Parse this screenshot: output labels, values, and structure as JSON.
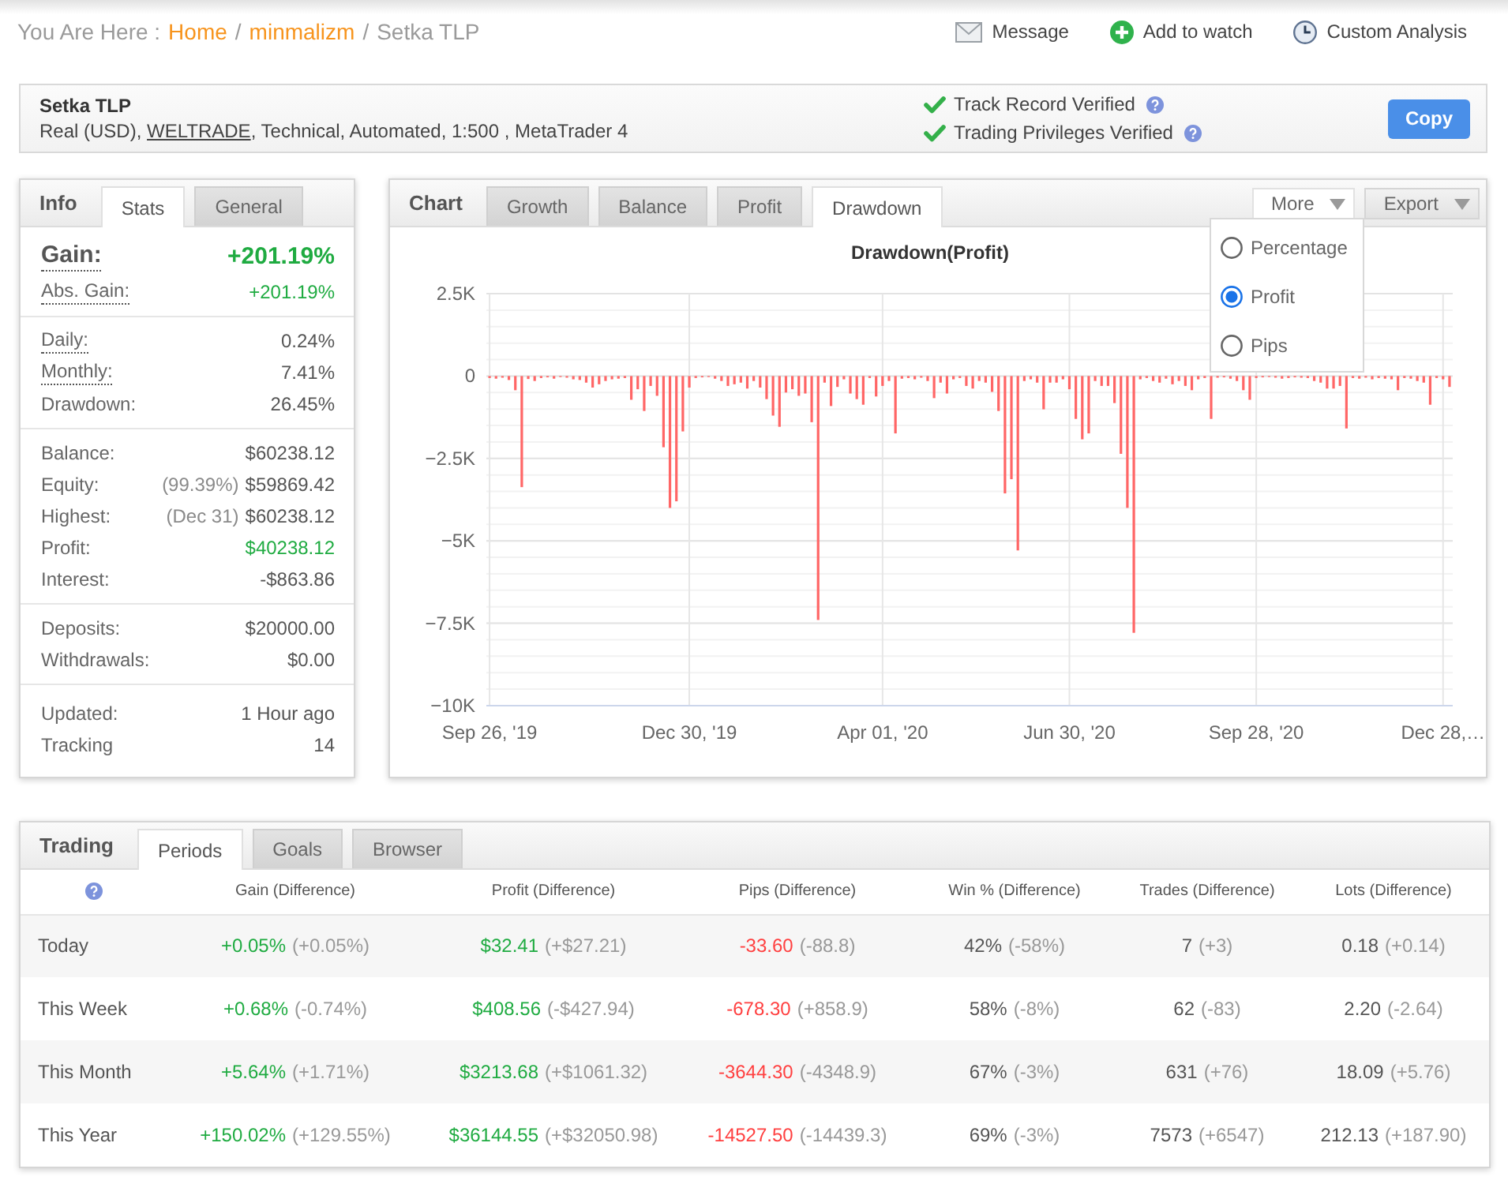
{
  "breadcrumb": {
    "prefix": "You Are Here :",
    "separator": "/",
    "items": [
      {
        "label": "Home",
        "link": true
      },
      {
        "label": "minmalizm",
        "link": true
      },
      {
        "label": "Setka TLP",
        "link": false
      }
    ]
  },
  "actions": [
    {
      "kind": "message",
      "label": "Message"
    },
    {
      "kind": "watch",
      "label": "Add to watch"
    },
    {
      "kind": "analysis",
      "label": "Custom Analysis"
    }
  ],
  "account": {
    "name": "Setka TLP",
    "details": [
      {
        "text": "Real (USD), ",
        "link": false
      },
      {
        "text": "WELTRADE",
        "link": true
      },
      {
        "text": ", Technical, Automated, 1:500 , MetaTrader 4",
        "link": false
      }
    ],
    "verifications": [
      {
        "label": "Track Record Verified",
        "verified": true
      },
      {
        "label": "Trading Privileges Verified",
        "verified": true
      }
    ],
    "copy_button": "Copy"
  },
  "info": {
    "title": "Info",
    "tabs": [
      {
        "label": "Stats",
        "selected": true
      },
      {
        "label": "General",
        "selected": false
      }
    ],
    "groups": [
      {
        "rows": [
          {
            "kind": "headline",
            "label": "Gain:",
            "value": "+201.19%",
            "color": "#1fab41",
            "hint": true
          },
          {
            "kind": "stat",
            "label": "Abs. Gain:",
            "value": "+201.19%",
            "color": "#1fab41",
            "hint": true
          }
        ]
      },
      {
        "rows": [
          {
            "kind": "stat",
            "label": "Daily:",
            "value": "0.24%",
            "color": "#555555",
            "hint": true
          },
          {
            "kind": "stat",
            "label": "Monthly:",
            "value": "7.41%",
            "color": "#555555",
            "hint": true
          },
          {
            "kind": "stat",
            "label": "Drawdown:",
            "value": "26.45%",
            "color": "#555555",
            "hint": false
          }
        ]
      },
      {
        "rows": [
          {
            "kind": "stat",
            "label": "Balance:",
            "value": "$60238.12",
            "color": "#555555",
            "hint": false
          },
          {
            "kind": "stat",
            "label": "Equity:",
            "note": "(99.39%)",
            "value": "$59869.42",
            "color": "#555555",
            "hint": false
          },
          {
            "kind": "stat",
            "label": "Highest:",
            "note": "(Dec 31)",
            "value": "$60238.12",
            "color": "#555555",
            "hint": false
          },
          {
            "kind": "stat",
            "label": "Profit:",
            "value": "$40238.12",
            "color": "#1fab41",
            "hint": false
          },
          {
            "kind": "stat",
            "label": "Interest:",
            "value": "-$863.86",
            "color": "#555555",
            "hint": false
          }
        ]
      },
      {
        "rows": [
          {
            "kind": "stat",
            "label": "Deposits:",
            "value": "$20000.00",
            "color": "#555555",
            "hint": false
          },
          {
            "kind": "stat",
            "label": "Withdrawals:",
            "value": "$0.00",
            "color": "#555555",
            "hint": false
          }
        ]
      },
      {
        "rows": [
          {
            "kind": "stat",
            "label": "Updated:",
            "value": "1 Hour ago",
            "color": "#555555",
            "hint": false
          },
          {
            "kind": "stat",
            "label": "Tracking",
            "value": "14",
            "color": "#555555",
            "hint": false
          }
        ]
      }
    ]
  },
  "chart_panel": {
    "title": "Chart",
    "tabs": [
      {
        "label": "Growth",
        "selected": false
      },
      {
        "label": "Balance",
        "selected": false
      },
      {
        "label": "Profit",
        "selected": false
      },
      {
        "label": "Drawdown",
        "selected": true
      }
    ],
    "menus": [
      {
        "label": "More",
        "open": true,
        "options": [
          {
            "label": "Percentage",
            "selected": false
          },
          {
            "label": "Profit",
            "selected": true
          },
          {
            "label": "Pips",
            "selected": false
          }
        ]
      },
      {
        "label": "Export",
        "open": false
      }
    ],
    "chart_data": {
      "type": "bar",
      "title": "Drawdown(Profit)",
      "grid": true,
      "categories": [
        "Sep 26, '19",
        null,
        null,
        null,
        null,
        null,
        null,
        null,
        null,
        null,
        null,
        null,
        null,
        null,
        null,
        null,
        null,
        null,
        null,
        null,
        null,
        null,
        null,
        null,
        null,
        null,
        null,
        null,
        null,
        null,
        null,
        "Dec 30, '19",
        null,
        null,
        null,
        null,
        null,
        null,
        null,
        null,
        null,
        null,
        null,
        null,
        null,
        null,
        null,
        null,
        null,
        null,
        null,
        null,
        null,
        null,
        null,
        null,
        null,
        null,
        null,
        null,
        null,
        "Apr 01, '20",
        null,
        null,
        null,
        null,
        null,
        null,
        null,
        null,
        null,
        null,
        null,
        null,
        null,
        null,
        null,
        null,
        null,
        null,
        null,
        null,
        null,
        null,
        null,
        null,
        null,
        null,
        null,
        null,
        "Jun 30, '20",
        null,
        null,
        null,
        null,
        null,
        null,
        null,
        null,
        null,
        null,
        null,
        null,
        null,
        null,
        null,
        null,
        null,
        null,
        null,
        null,
        null,
        null,
        null,
        null,
        null,
        null,
        null,
        null,
        "Sep 28, '20",
        null,
        null,
        null,
        null,
        null,
        null,
        null,
        null,
        null,
        null,
        null,
        null,
        null,
        null,
        null,
        null,
        null,
        null,
        null,
        null,
        null,
        null,
        null,
        null,
        null,
        null,
        null,
        null,
        "Dec 28,…",
        null
      ],
      "series": [
        {
          "color": "#ff6666",
          "values": [
            -60,
            -80,
            -50,
            -120,
            -430,
            -3370,
            -90,
            -150,
            -60,
            -40,
            -80,
            -30,
            -50,
            -100,
            -120,
            -200,
            -350,
            -250,
            -150,
            -100,
            -80,
            -60,
            -720,
            -400,
            -1060,
            -300,
            -600,
            -2160,
            -4000,
            -3800,
            -1680,
            -350,
            -60,
            -40,
            -30,
            -80,
            -150,
            -300,
            -250,
            -200,
            -380,
            -150,
            -350,
            -700,
            -1200,
            -1540,
            -500,
            -400,
            -600,
            -530,
            -1400,
            -7400,
            -200,
            -910,
            -330,
            -100,
            -530,
            -700,
            -870,
            -60,
            -620,
            -300,
            -150,
            -1740,
            -80,
            -60,
            -100,
            -50,
            -150,
            -670,
            -200,
            -530,
            -100,
            -60,
            -300,
            -380,
            -150,
            -200,
            -480,
            -1060,
            -3560,
            -3130,
            -5290,
            -150,
            -100,
            -200,
            -1010,
            -200,
            -200,
            -100,
            -400,
            -1300,
            -1920,
            -1740,
            -150,
            -300,
            -300,
            -820,
            -2360,
            -4000,
            -7790,
            -100,
            -60,
            -150,
            -200,
            -80,
            -250,
            -150,
            -300,
            -430,
            -100,
            -60,
            -1300,
            -50,
            -40,
            -80,
            -150,
            -430,
            -720,
            -60,
            -40,
            -30,
            -50,
            -80,
            -60,
            -40,
            -50,
            -60,
            -150,
            -200,
            -380,
            -380,
            -300,
            -1590,
            -60,
            -80,
            -50,
            -100,
            -60,
            -80,
            -100,
            -430,
            -60,
            -80,
            -150,
            -200,
            -870,
            -60,
            -100,
            -330
          ]
        }
      ],
      "ylim": [
        -10000,
        2500
      ],
      "yticks": [
        {
          "value": 2500,
          "label": "2.5K"
        },
        {
          "value": 0,
          "label": "0"
        },
        {
          "value": -2500,
          "label": "−2.5K"
        },
        {
          "value": -5000,
          "label": "−5K"
        },
        {
          "value": -7500,
          "label": "−7.5K"
        },
        {
          "value": -10000,
          "label": "−10K"
        }
      ]
    }
  },
  "trading": {
    "title": "Trading",
    "tabs": [
      {
        "label": "Periods",
        "selected": true
      },
      {
        "label": "Goals",
        "selected": false
      },
      {
        "label": "Browser",
        "selected": false
      }
    ],
    "columns": [
      {
        "heading": "Gain (Difference)",
        "color": "#1fab41"
      },
      {
        "heading": "Profit (Difference)",
        "color": "#1fab41"
      },
      {
        "heading": "Pips (Difference)",
        "color": "#ff4040"
      },
      {
        "heading": "Win % (Difference)",
        "color": "#555555"
      },
      {
        "heading": "Trades (Difference)",
        "color": "#555555"
      },
      {
        "heading": "Lots (Difference)",
        "color": "#555555"
      }
    ],
    "rows": [
      {
        "period": "Today",
        "cells": [
          {
            "value": "+0.05%",
            "difference": "(+0.05%)"
          },
          {
            "value": "$32.41",
            "difference": "(+$27.21)"
          },
          {
            "value": "-33.60",
            "difference": "(-88.8)"
          },
          {
            "value": "42%",
            "difference": "(-58%)"
          },
          {
            "value": "7",
            "difference": "(+3)"
          },
          {
            "value": "0.18",
            "difference": "(+0.14)"
          }
        ]
      },
      {
        "period": "This Week",
        "cells": [
          {
            "value": "+0.68%",
            "difference": "(-0.74%)"
          },
          {
            "value": "$408.56",
            "difference": "(-$427.94)"
          },
          {
            "value": "-678.30",
            "difference": "(+858.9)"
          },
          {
            "value": "58%",
            "difference": "(-8%)"
          },
          {
            "value": "62",
            "difference": "(-83)"
          },
          {
            "value": "2.20",
            "difference": "(-2.64)"
          }
        ]
      },
      {
        "period": "This Month",
        "cells": [
          {
            "value": "+5.64%",
            "difference": "(+1.71%)"
          },
          {
            "value": "$3213.68",
            "difference": "(+$1061.32)"
          },
          {
            "value": "-3644.30",
            "difference": "(-4348.9)"
          },
          {
            "value": "67%",
            "difference": "(-3%)"
          },
          {
            "value": "631",
            "difference": "(+76)"
          },
          {
            "value": "18.09",
            "difference": "(+5.76)"
          }
        ]
      },
      {
        "period": "This Year",
        "cells": [
          {
            "value": "+150.02%",
            "difference": "(+129.55%)"
          },
          {
            "value": "$36144.55",
            "difference": "(+$32050.98)"
          },
          {
            "value": "-14527.50",
            "difference": "(-14439.3)"
          },
          {
            "value": "69%",
            "difference": "(-3%)"
          },
          {
            "value": "7573",
            "difference": "(+6547)"
          },
          {
            "value": "212.13",
            "difference": "(+187.90)"
          }
        ]
      }
    ]
  }
}
